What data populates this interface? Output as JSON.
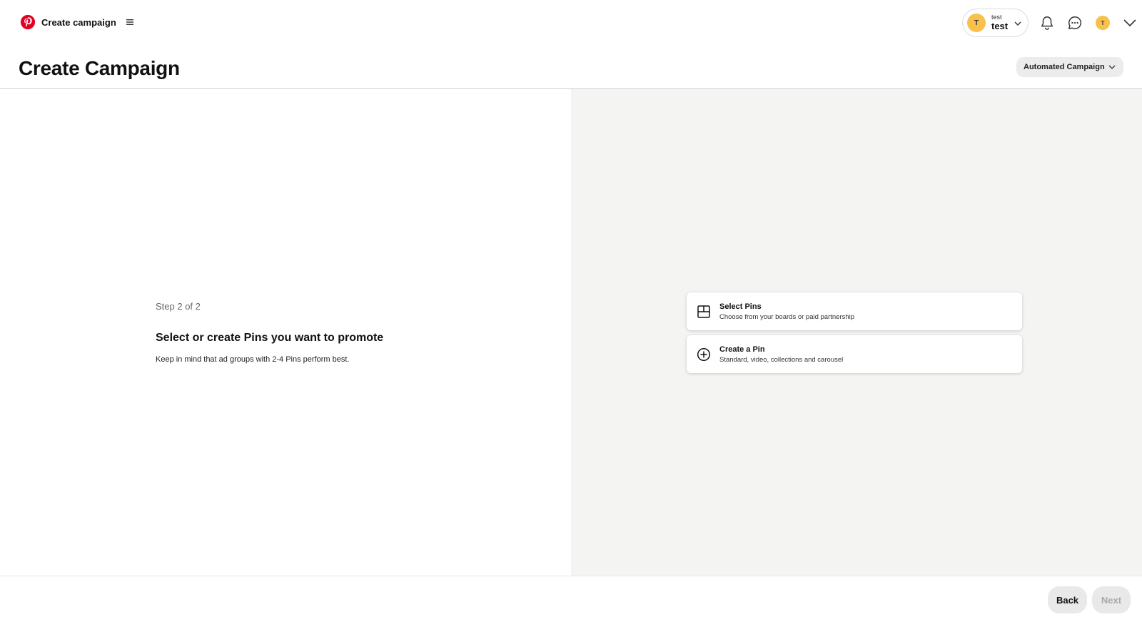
{
  "topnav": {
    "title": "Create campaign",
    "account": {
      "avatar_initial": "T",
      "small_name": "test",
      "name": "test"
    },
    "profile_avatar_initial": "T"
  },
  "header": {
    "title": "Create Campaign",
    "campaign_type": "Automated Campaign"
  },
  "main": {
    "step": "Step 2 of 2",
    "heading": "Select or create Pins you want to promote",
    "subtext": "Keep in mind that ad groups with 2-4 Pins perform best.",
    "options": [
      {
        "title": "Select Pins",
        "description": "Choose from your boards or paid partnership",
        "icon": "grid-icon"
      },
      {
        "title": "Create a Pin",
        "description": "Standard, video, collections and carousel",
        "icon": "plus-circle-icon"
      }
    ]
  },
  "footer": {
    "back_label": "Back",
    "next_label": "Next"
  },
  "colors": {
    "brand": "#e60023",
    "avatar": "#f7c14b",
    "right_pane_bg": "#f4f4f2"
  }
}
